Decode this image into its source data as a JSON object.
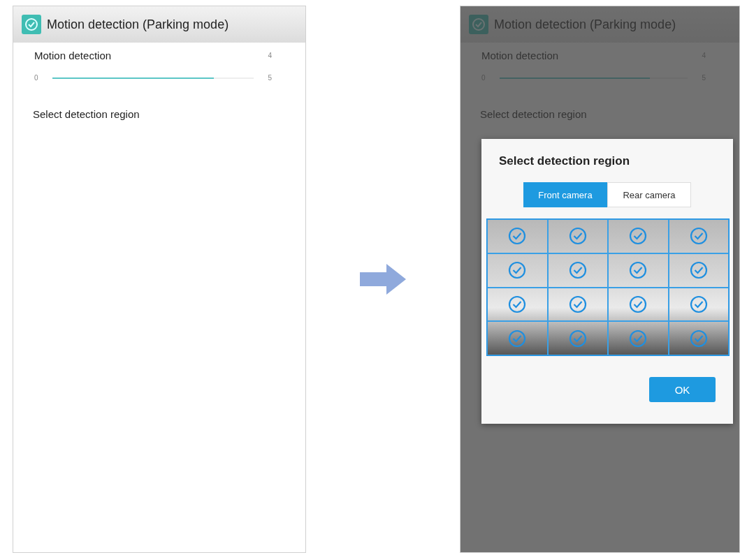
{
  "screens": [
    {
      "title": "Motion detection (Parking mode)",
      "setting_label": "Motion detection",
      "value": "4",
      "min": "0",
      "max": "5",
      "level": 0.8,
      "region_label": "Select detection region",
      "dimmed": false
    },
    {
      "title": "Motion detection (Parking mode)",
      "setting_label": "Motion detection",
      "value": "4",
      "min": "0",
      "max": "5",
      "level": 0.8,
      "region_label": "Select detection region",
      "dimmed": true,
      "dialog": {
        "title": "Select detection region",
        "tabs": [
          {
            "label": "Front camera",
            "selected": true
          },
          {
            "label": "Rear camera",
            "selected": false
          }
        ],
        "cells": [
          {
            "checked": true
          },
          {
            "checked": true
          },
          {
            "checked": true
          },
          {
            "checked": true
          },
          {
            "checked": true
          },
          {
            "checked": true
          },
          {
            "checked": true
          },
          {
            "checked": true
          },
          {
            "checked": true
          },
          {
            "checked": true
          },
          {
            "checked": true
          },
          {
            "checked": true
          },
          {
            "checked": true
          },
          {
            "checked": true
          },
          {
            "checked": true
          },
          {
            "checked": true
          }
        ],
        "ok_button": "OK"
      }
    }
  ]
}
